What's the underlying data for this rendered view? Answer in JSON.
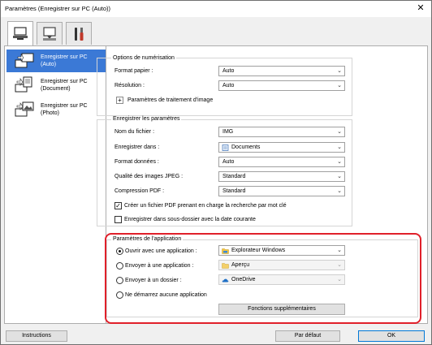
{
  "window": {
    "title": "Paramètres (Enregistrer sur PC (Auto))",
    "close_glyph": "✕"
  },
  "tabs": [
    {
      "icon": "computer-scan-icon"
    },
    {
      "icon": "scanner-icon"
    },
    {
      "icon": "tools-icon"
    }
  ],
  "sidebar": {
    "items": [
      {
        "label": "Enregistrer sur PC (Auto)"
      },
      {
        "label": "Enregistrer sur PC (Document)"
      },
      {
        "label": "Enregistrer sur PC (Photo)"
      }
    ]
  },
  "scan_options": {
    "title": "Options de numérisation",
    "paper_size": {
      "label": "Format papier :",
      "value": "Auto"
    },
    "resolution": {
      "label": "Résolution :",
      "value": "Auto"
    },
    "image_processing": {
      "label": "Paramètres de traitement d'image"
    }
  },
  "save_settings": {
    "title": "Enregistrer les paramètres",
    "file_name": {
      "label": "Nom du fichier :",
      "value": "IMG"
    },
    "save_in": {
      "label": "Enregistrer dans :",
      "value": "Documents"
    },
    "data_format": {
      "label": "Format données :",
      "value": "Auto"
    },
    "jpeg_quality": {
      "label": "Qualité des images JPEG :",
      "value": "Standard"
    },
    "pdf_compression": {
      "label": "Compression PDF :",
      "value": "Standard"
    },
    "searchable_pdf": {
      "label": "Créer un fichier PDF prenant en charge la recherche par mot clé",
      "checked": true
    },
    "date_subfolder": {
      "label": "Enregistrer dans sous-dossier avec la date courante",
      "checked": false
    }
  },
  "app_settings": {
    "title": "Paramètres de l'application",
    "open_app": {
      "label": "Ouvrir avec une application :",
      "value": "Explorateur Windows",
      "selected": true
    },
    "send_app": {
      "label": "Envoyer à une application :",
      "value": "Aperçu",
      "selected": false
    },
    "send_folder": {
      "label": "Envoyer à un dossier :",
      "value": "OneDrive",
      "selected": false
    },
    "no_app": {
      "label": "Ne démarrez aucune application",
      "selected": false
    },
    "more_functions": "Fonctions supplémentaires"
  },
  "footer": {
    "instructions": "Instructions",
    "defaults": "Par défaut",
    "ok": "OK"
  },
  "highlight_color": "#e0202a",
  "selection_color": "#3b79d6"
}
